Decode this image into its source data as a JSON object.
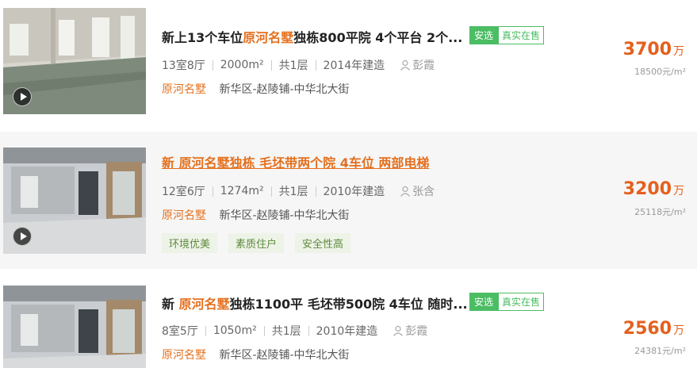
{
  "listings": [
    {
      "title_prefix": "新上13个车位",
      "title_highlight": "原河名墅",
      "title_suffix": "独栋800平院 4个平台 2个...",
      "tag_safe": "安选",
      "tag_real": "真实在售",
      "rooms": "13室8厅",
      "area": "2000m²",
      "floors": "共1层",
      "year": "2014年建造",
      "agent": "彭霞",
      "community": "原河名墅",
      "district": "新华区-赵陵铺-中华北大街",
      "price": "3700",
      "price_unit": "万",
      "unit_price": "18500元/m²"
    },
    {
      "title": "新 原河名墅独栋 毛坯带两个院 4车位 两部电梯",
      "rooms": "12室6厅",
      "area": "1274m²",
      "floors": "共1层",
      "year": "2010年建造",
      "agent": "张含",
      "community": "原河名墅",
      "district": "新华区-赵陵铺-中华北大街",
      "features": [
        "环境优美",
        "素质住户",
        "安全性高"
      ],
      "price": "3200",
      "price_unit": "万",
      "unit_price": "25118元/m²"
    },
    {
      "title_prefix": "新 ",
      "title_highlight": "原河名墅",
      "title_suffix": "独栋1100平 毛坯带500院 4车位 随时...",
      "tag_safe": "安选",
      "tag_real": "真实在售",
      "rooms": "8室5厅",
      "area": "1050m²",
      "floors": "共1层",
      "year": "2010年建造",
      "agent": "彭霞",
      "community": "原河名墅",
      "district": "新华区-赵陵铺-中华北大街",
      "price": "2560",
      "price_unit": "万",
      "unit_price": "24381元/m²"
    }
  ]
}
